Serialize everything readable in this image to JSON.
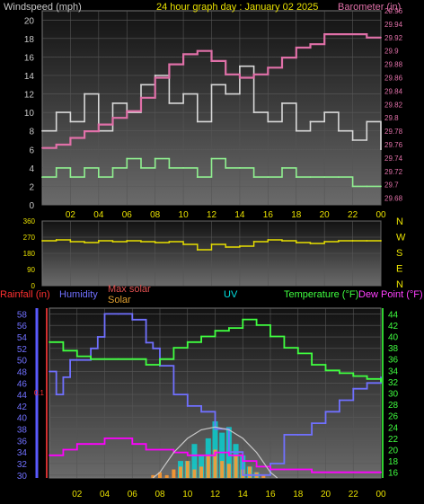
{
  "chart_data": [
    {
      "type": "line",
      "title": "24 hour graph day : January 02 2025",
      "ylabel": "Windspeed (mph)",
      "y2label": "Barometer (in)",
      "ylim": [
        0,
        21
      ],
      "y2lim": [
        29.67,
        29.96
      ],
      "yticks": [
        0,
        2,
        4,
        6,
        8,
        10,
        12,
        14,
        16,
        18,
        20
      ],
      "y2ticks": [
        "29.68",
        "29.7",
        "29.72",
        "29.74",
        "29.76",
        "29.78",
        "29.8",
        "29.82",
        "29.84",
        "29.86",
        "29.88",
        "29.9",
        "29.92",
        "29.94",
        "29.96"
      ],
      "xticks": [
        "02",
        "04",
        "06",
        "08",
        "10",
        "12",
        "14",
        "16",
        "18",
        "20",
        "22",
        "00"
      ],
      "series": [
        {
          "key": "gust",
          "color": "#d8d8d8",
          "x": [
            0,
            1,
            2,
            3,
            4,
            5,
            6,
            7,
            8,
            9,
            10,
            11,
            12,
            13,
            14,
            15,
            16,
            17,
            18,
            19,
            20,
            21,
            22,
            23,
            24
          ],
          "values": [
            8,
            10,
            9,
            12,
            8,
            11,
            10,
            13,
            14,
            11,
            12,
            9,
            13,
            12,
            15,
            10,
            9,
            11,
            8,
            9,
            10,
            8,
            7,
            9,
            6
          ]
        },
        {
          "key": "avg",
          "color": "#90f090",
          "x": [
            0,
            1,
            2,
            3,
            4,
            5,
            6,
            7,
            8,
            9,
            10,
            11,
            12,
            13,
            14,
            15,
            16,
            17,
            18,
            19,
            20,
            21,
            22,
            23,
            24
          ],
          "values": [
            3,
            4,
            3,
            4,
            3,
            4,
            5,
            4,
            5,
            4,
            4,
            3,
            5,
            4,
            4,
            3,
            3,
            4,
            3,
            3,
            3,
            3,
            2,
            2,
            2
          ]
        },
        {
          "key": "barometer",
          "color": "#e070a8",
          "x": [
            0,
            1,
            2,
            3,
            4,
            5,
            6,
            7,
            8,
            9,
            10,
            11,
            12,
            13,
            14,
            15,
            16,
            17,
            18,
            19,
            20,
            21,
            22,
            23,
            24
          ],
          "values": [
            29.755,
            29.76,
            29.77,
            29.78,
            29.79,
            29.8,
            29.81,
            29.83,
            29.86,
            29.88,
            29.895,
            29.9,
            29.885,
            29.865,
            29.86,
            29.865,
            29.875,
            29.89,
            29.905,
            29.91,
            29.925,
            29.925,
            29.925,
            29.92,
            29.92
          ]
        }
      ]
    },
    {
      "type": "line",
      "yticks": [
        "360",
        "270",
        "180",
        "90",
        "0"
      ],
      "compass": [
        "N",
        "W",
        "S",
        "E",
        "N"
      ],
      "ylim": [
        0,
        360
      ],
      "xticks": [
        "02",
        "04",
        "06",
        "08",
        "10",
        "12",
        "14",
        "16",
        "18",
        "20",
        "22",
        "00"
      ],
      "series": [
        {
          "key": "wind-direction",
          "color": "#e8e000",
          "x": [
            0,
            1,
            2,
            3,
            4,
            5,
            6,
            7,
            8,
            9,
            10,
            11,
            12,
            13,
            14,
            15,
            16,
            17,
            18,
            19,
            20,
            21,
            22,
            23,
            24
          ],
          "values": [
            250,
            255,
            245,
            240,
            250,
            245,
            250,
            245,
            240,
            245,
            230,
            200,
            230,
            215,
            220,
            245,
            255,
            250,
            240,
            235,
            245,
            250,
            250,
            250,
            250
          ]
        }
      ]
    },
    {
      "type": "line",
      "labels": {
        "rainfall": "Rainfall (in)",
        "humidity": "Humidity",
        "max_solar": "Max solar",
        "solar": "Solar",
        "uv": "UV",
        "temperature": "Temperature (°F)",
        "dew_point": "Dew Point (°F)"
      },
      "humidity_ticks": [
        30,
        32,
        34,
        36,
        38,
        40,
        42,
        44,
        46,
        48,
        50,
        52,
        54,
        56,
        58
      ],
      "humidity_lim": [
        29.5,
        59
      ],
      "rain_ticks": [
        "0.1"
      ],
      "temp_ticks": [
        16,
        18,
        20,
        22,
        24,
        26,
        28,
        30,
        32,
        34,
        36,
        38,
        40,
        42,
        44
      ],
      "temp_lim": [
        15,
        45
      ],
      "xticks": [
        "02",
        "04",
        "06",
        "08",
        "10",
        "12",
        "14",
        "16",
        "18",
        "20",
        "22",
        "00"
      ],
      "series": [
        {
          "key": "humidity",
          "color": "#7070ff",
          "x": [
            0,
            0.5,
            1,
            1.5,
            2,
            3,
            3.5,
            4,
            5,
            6,
            7,
            7.5,
            8,
            9,
            10,
            11,
            12,
            13,
            14,
            15,
            16,
            17,
            18,
            19,
            20,
            21,
            22,
            23,
            24
          ],
          "values": [
            48,
            44,
            47,
            50,
            50,
            52,
            54,
            58,
            58,
            57,
            53,
            52,
            49,
            44,
            42,
            41,
            38,
            34,
            30,
            30,
            32,
            37,
            37,
            39,
            41,
            43,
            45,
            46,
            47
          ]
        },
        {
          "key": "temperature",
          "color": "#40ff40",
          "x": [
            0,
            1,
            2,
            3,
            4,
            5,
            6,
            7,
            8,
            9,
            10,
            11,
            12,
            13,
            14,
            15,
            16,
            17,
            18,
            19,
            20,
            21,
            22,
            23,
            24
          ],
          "values": [
            39,
            37.5,
            36.5,
            36,
            36,
            36,
            36,
            35,
            36,
            38,
            39,
            40,
            41,
            41.5,
            43,
            42,
            40,
            38,
            37,
            35,
            34,
            33.5,
            33,
            32.5,
            32
          ]
        },
        {
          "key": "dew-point",
          "color": "#ff00ff",
          "x": [
            0,
            1,
            2,
            3,
            4,
            5,
            6,
            7,
            8,
            9,
            10,
            11,
            12,
            13,
            14,
            15,
            16,
            17,
            18,
            19,
            20,
            21,
            22,
            23,
            24
          ],
          "values": [
            19,
            20,
            21,
            21,
            22,
            22,
            21,
            20,
            20,
            19.5,
            19,
            19,
            19.5,
            19,
            18,
            17,
            16.5,
            16.5,
            16.5,
            16,
            16,
            16,
            16,
            16,
            16
          ]
        },
        {
          "key": "max-solar",
          "color": "#c8c8c8",
          "x": [
            7.5,
            8,
            9,
            10,
            11,
            12,
            13,
            14,
            15,
            16,
            16.5
          ],
          "values": [
            15,
            16,
            19.5,
            22,
            23.5,
            24,
            23.5,
            22,
            19.5,
            16,
            15
          ]
        },
        {
          "key": "uv",
          "color": "#00e0e0",
          "x": [
            9.5,
            10,
            10.5,
            11,
            11.5,
            12,
            12.5,
            13,
            13.5,
            14,
            14.5,
            15
          ],
          "values": [
            18,
            18,
            21,
            19,
            22,
            25,
            23,
            24,
            21,
            19,
            17,
            16
          ]
        },
        {
          "key": "solar",
          "color": "#ff9a30",
          "x": [
            7.5,
            8,
            8.5,
            9,
            9.5,
            10,
            10.5,
            11,
            11.5,
            12,
            12.5,
            13,
            13.5,
            14,
            14.5,
            15,
            15.5
          ],
          "values": [
            15.5,
            16,
            15.5,
            16.5,
            17,
            18,
            16.5,
            17,
            19,
            20,
            18,
            17.5,
            19,
            16.5,
            17,
            16,
            15.5
          ]
        }
      ]
    }
  ]
}
